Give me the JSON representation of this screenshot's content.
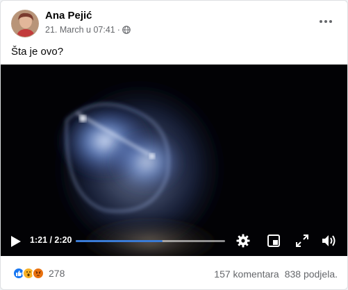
{
  "post": {
    "author": "Ana Pejić",
    "timestamp": "21. March u 07:41",
    "separator": "·",
    "privacy_icon": "globe-icon",
    "menu_icon": "more-options-icon",
    "text": "Šta je ovo?"
  },
  "video": {
    "time": "1:21 / 2:20",
    "progress": 0.58,
    "controls": [
      "play-icon",
      "settings-gear-icon",
      "picture-in-picture-icon",
      "fullscreen-icon",
      "volume-icon"
    ]
  },
  "footer": {
    "reaction_icons": [
      "like-icon",
      "wow-icon",
      "angry-icon"
    ],
    "reaction_count": "278",
    "comments": "157 komentara",
    "shares": "838 podjela."
  },
  "colors": {
    "progress_fill": "#3a7bd5",
    "like": "#1877f2",
    "wow": "#f7b125",
    "angry": "#e9710f",
    "secondary_text": "#65676b"
  }
}
